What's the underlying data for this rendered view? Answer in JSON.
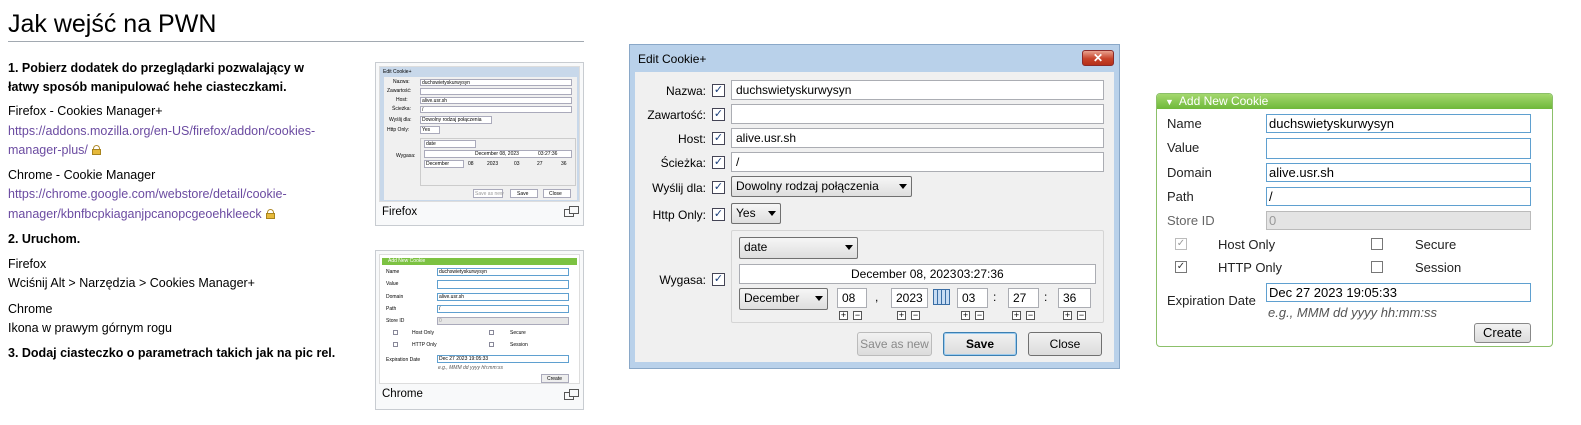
{
  "article": {
    "title": "Jak wejść na PWN",
    "step1a": "1. Pobierz dodatek do przeglądarki pozwalający w",
    "step1b": "łatwy sposób manipulować hehe ciasteczkami.",
    "firefox_addon": "Firefox - Cookies Manager+",
    "firefox_url_1": "https://addons.mozilla.org/en-US/firefox/addon/cookies-",
    "firefox_url_2": "manager-plus/",
    "chrome_addon": "Chrome - Cookie Manager",
    "chrome_url_1": "https://chrome.google.com/webstore/detail/cookie-",
    "chrome_url_2": "manager/kbnfbcpkiaganjpcanopcgeoehkleeck",
    "step2": "2. Uruchom.",
    "firefox_label": "Firefox",
    "firefox_howto": "Wciśnij Alt > Narzędzia > Cookies Manager+",
    "chrome_label": "Chrome",
    "chrome_howto": "Ikona w prawym górnym rogu",
    "step3": "3. Dodaj ciasteczko o parametrach takich jak na pic rel.",
    "thumb1_caption": "Firefox",
    "thumb2_caption": "Chrome"
  },
  "dialog": {
    "title": "Edit Cookie+",
    "close_glyph": "✕",
    "labels": {
      "name": "Nazwa:",
      "content": "Zawartość:",
      "host": "Host:",
      "path": "Ścieżka:",
      "send_for": "Wyślij dla:",
      "http_only": "Http Only:",
      "expires": "Wygasa:"
    },
    "values": {
      "name": "duchswietyskurwysyn",
      "content": "",
      "host": "alive.usr.sh",
      "path": "/",
      "send_for": "Dowolny rodzaj połączenia",
      "http_only": "Yes",
      "expire_type": "date",
      "expire_display": "December 08, 2023",
      "expire_time": "03:27:36",
      "month": "December",
      "day": "08",
      "year": "2023",
      "hour": "03",
      "minute": "27",
      "second": "36"
    },
    "sep_comma": ",",
    "sep_colon": ":",
    "plus": "+",
    "minus": "−",
    "check": "✓",
    "buttons": {
      "save_as_new": "Save as new",
      "save": "Save",
      "close": "Close"
    }
  },
  "add_cookie": {
    "header": "Add New Cookie",
    "labels": {
      "name": "Name",
      "value": "Value",
      "domain": "Domain",
      "path": "Path",
      "store_id": "Store ID",
      "host_only": "Host Only",
      "secure": "Secure",
      "http_only": "HTTP Only",
      "session": "Session",
      "expiration": "Expiration Date"
    },
    "values": {
      "name": "duchswietyskurwysyn",
      "value": "",
      "domain": "alive.usr.sh",
      "path": "/",
      "store_id": "0",
      "expiration": "Dec 27 2023 19:05:33"
    },
    "checks": {
      "host_only": true,
      "secure": false,
      "http_only": true,
      "session": false
    },
    "hint": "e.g., MMM dd yyyy hh:mm:ss",
    "create_button": "Create"
  },
  "colors": {
    "link": "#6b4ba1",
    "header_green": "#7cc242",
    "dialog_frame": "#b9d1ea"
  }
}
